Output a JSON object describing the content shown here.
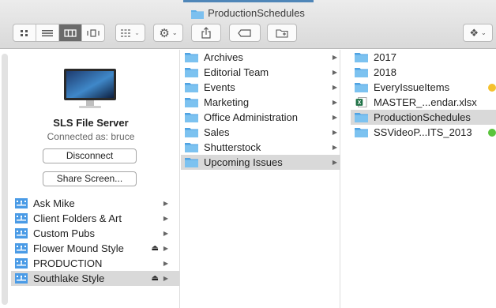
{
  "window": {
    "title": "ProductionSchedules"
  },
  "toolbar": {
    "views": [
      "icon-view",
      "list-view",
      "column-view",
      "cover-flow-view"
    ],
    "active_view": "column-view"
  },
  "server": {
    "name": "SLS File Server",
    "connected": "Connected as: bruce",
    "disconnect_label": "Disconnect",
    "share_label": "Share Screen..."
  },
  "sidebar": {
    "items": [
      {
        "label": "Ask Mike",
        "eject": false,
        "selected": false
      },
      {
        "label": "Client Folders & Art",
        "eject": false,
        "selected": false
      },
      {
        "label": "Custom Pubs",
        "eject": false,
        "selected": false
      },
      {
        "label": "Flower Mound Style",
        "eject": true,
        "selected": false
      },
      {
        "label": "PRODUCTION",
        "eject": false,
        "selected": false
      },
      {
        "label": "Southlake Style",
        "eject": true,
        "selected": true
      }
    ],
    "eject_glyph": "⏏",
    "arrow_glyph": "▶"
  },
  "column2": {
    "items": [
      {
        "label": "Archives",
        "selected": false
      },
      {
        "label": "Editorial Team",
        "selected": false
      },
      {
        "label": "Events",
        "selected": false
      },
      {
        "label": "Marketing",
        "selected": false
      },
      {
        "label": "Office Administration",
        "selected": false
      },
      {
        "label": "Sales",
        "selected": false
      },
      {
        "label": "Shutterstock",
        "selected": false
      },
      {
        "label": "Upcoming Issues",
        "selected": true
      }
    ]
  },
  "column3": {
    "items": [
      {
        "label": "2017",
        "kind": "folder",
        "tag": ""
      },
      {
        "label": "2018",
        "kind": "folder",
        "tag": ""
      },
      {
        "label": "EveryIssueItems",
        "kind": "folder",
        "tag": "#f5c12e"
      },
      {
        "label": "MASTER_...endar.xlsx",
        "kind": "excel",
        "tag": ""
      },
      {
        "label": "ProductionSchedules",
        "kind": "folder",
        "tag": "",
        "selected": true
      },
      {
        "label": "SSVideoP...ITS_2013",
        "kind": "folder",
        "tag": "#5ac43c"
      }
    ]
  },
  "colors": {
    "folder": "#5fb0e8",
    "selection": "#d9d9d9"
  }
}
